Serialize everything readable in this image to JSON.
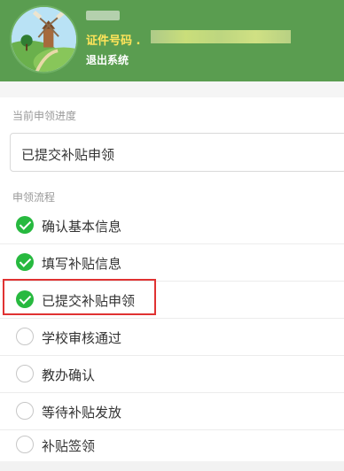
{
  "header": {
    "id_label": "证件号码 .",
    "logout": "退出系统"
  },
  "progress": {
    "title": "当前申领进度",
    "value": "已提交补贴申领"
  },
  "flow": {
    "title": "申领流程",
    "steps": [
      {
        "label": "确认基本信息",
        "status": "done"
      },
      {
        "label": "填写补贴信息",
        "status": "done"
      },
      {
        "label": "已提交补贴申领",
        "status": "done"
      },
      {
        "label": "学校审核通过",
        "status": "pending"
      },
      {
        "label": "教办确认",
        "status": "pending"
      },
      {
        "label": "等待补贴发放",
        "status": "pending"
      },
      {
        "label": "补贴签领",
        "status": "pending"
      }
    ]
  },
  "colors": {
    "header_bg": "#5a9d50",
    "id_label": "#ffe45a",
    "done": "#27b93f",
    "highlight": "#e03232"
  }
}
